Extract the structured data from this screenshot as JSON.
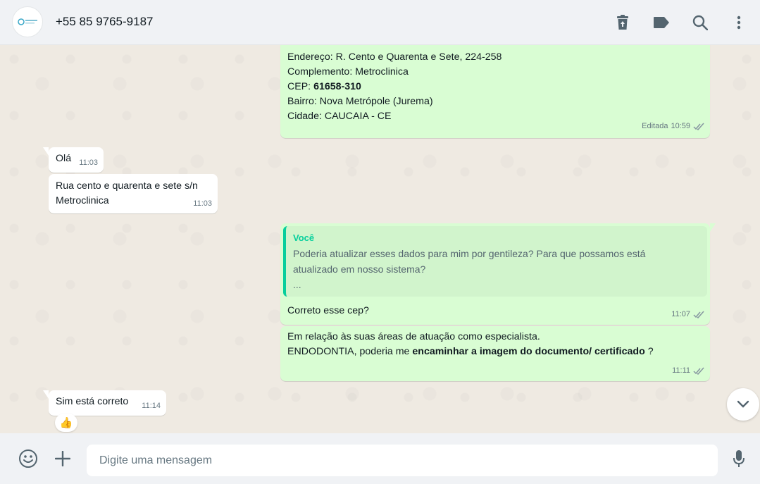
{
  "header": {
    "contact_name": "+55 85 9765-9187",
    "icons": [
      "delete-icon",
      "label-icon",
      "search-icon",
      "menu-icon"
    ]
  },
  "messages": {
    "m1": {
      "direction": "out",
      "lines": {
        "endereco": "Endereço: R. Cento e Quarenta e Sete, 224-258",
        "complemento": "Complemento:  Metroclinica",
        "cep_label": "CEP: ",
        "cep_value": "61658-310",
        "bairro": "Bairro: Nova Metrópole (Jurema)",
        "cidade": "Cidade: CAUCAIA - CE"
      },
      "edited": "Editada",
      "time": "10:59"
    },
    "m2": {
      "direction": "in",
      "text": "Olá",
      "time": "11:03"
    },
    "m3": {
      "direction": "in",
      "line1": "Rua cento e quarenta e sete s/n",
      "line2": "Metroclinica",
      "time": "11:03"
    },
    "m4": {
      "direction": "out",
      "quote_author": "Você",
      "quote_line1": "Poderia atualizar esses dados para mim por gentileza? Para que possamos está",
      "quote_line2": "atualizado em nosso sistema?",
      "quote_line3": "...",
      "text": "Correto esse cep?",
      "time": "11:07"
    },
    "m5": {
      "direction": "out",
      "line1": "Em relação às suas áreas de atuação como especialista.",
      "line2_prefix": "ENDODONTIA,  poderia me ",
      "line2_bold": "encaminhar a imagem do documento/ certificado",
      "line2_suffix": " ?",
      "time": "11:11"
    },
    "m6": {
      "direction": "in",
      "text": "Sim está correto",
      "time": "11:14",
      "reaction": "👍"
    }
  },
  "composer": {
    "placeholder": "Digite uma mensagem",
    "icons": [
      "emoji-icon",
      "attach-plus-icon",
      "microphone-icon"
    ]
  },
  "colors": {
    "header_bg": "#f0f2f5",
    "chat_bg": "#efeae2",
    "outgoing_bubble": "#d9fdd3",
    "incoming_bubble": "#ffffff",
    "accent": "#06cf9c",
    "read_ticks": "#8696a0"
  }
}
